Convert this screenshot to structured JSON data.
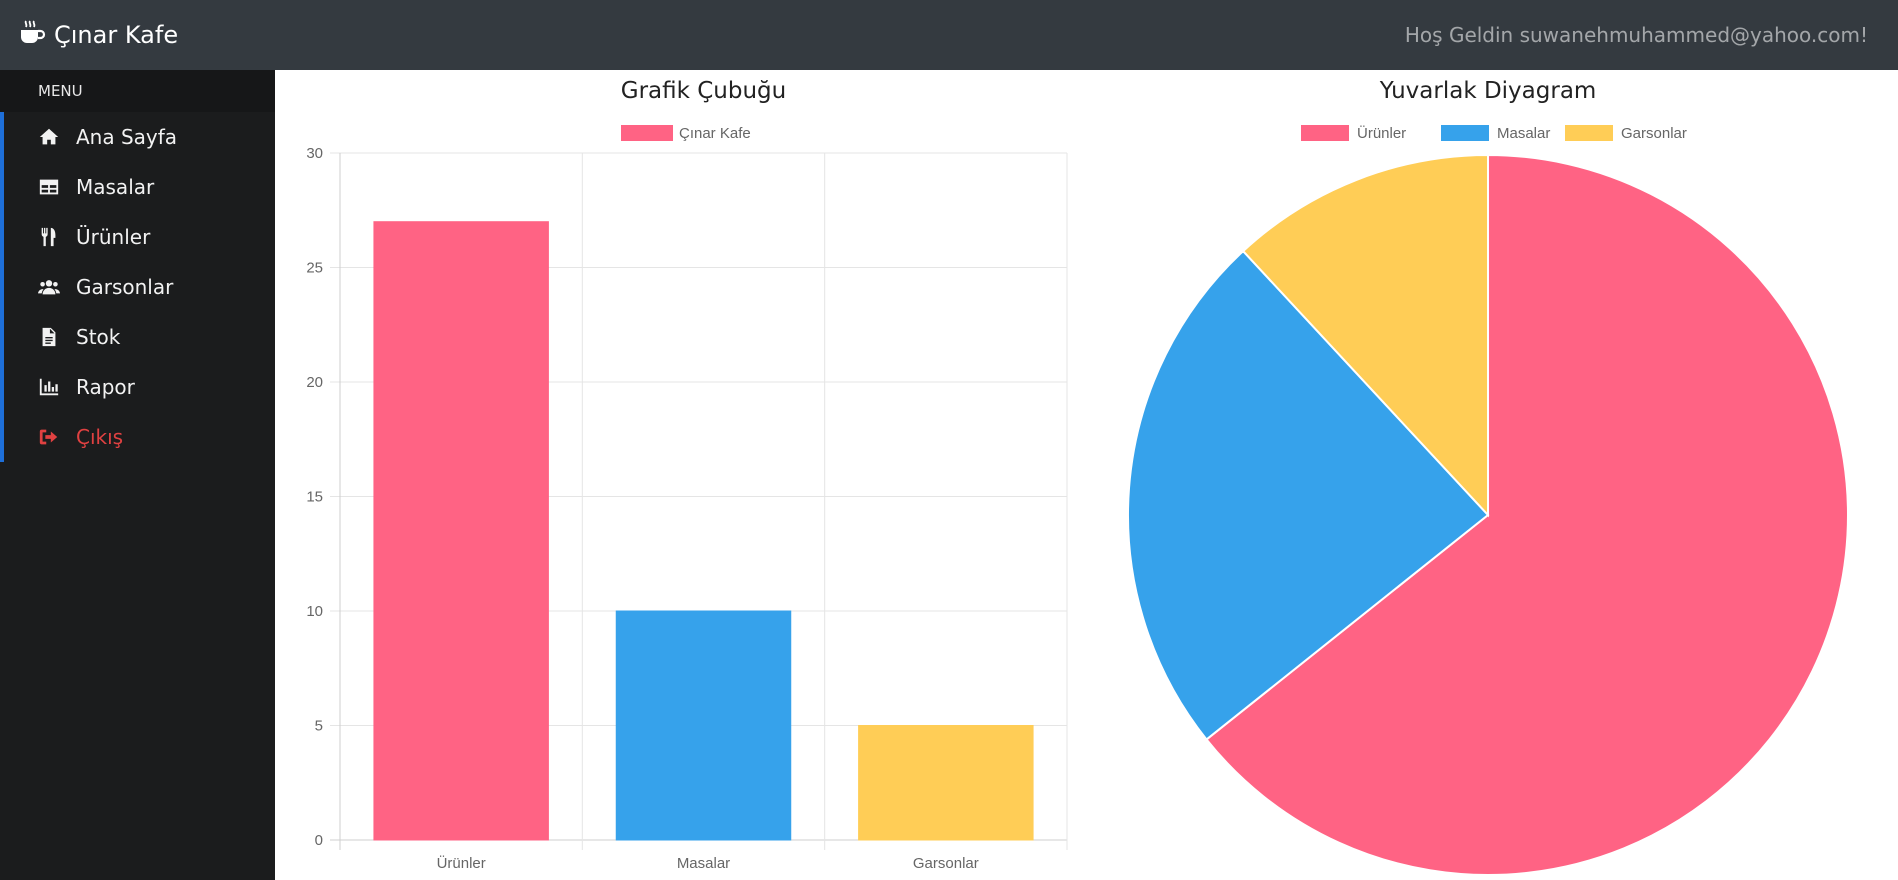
{
  "app": {
    "brand": "Çınar Kafe",
    "welcome": "Hoş Geldin suwanehmuhammed@yahoo.com!"
  },
  "sidebar": {
    "header": "MENU",
    "items": [
      {
        "label": "Ana Sayfa",
        "icon": "home-icon"
      },
      {
        "label": "Masalar",
        "icon": "table-icon"
      },
      {
        "label": "Ürünler",
        "icon": "utensils-icon"
      },
      {
        "label": "Garsonlar",
        "icon": "users-icon"
      },
      {
        "label": "Stok",
        "icon": "file-icon"
      },
      {
        "label": "Rapor",
        "icon": "bar-chart-icon"
      },
      {
        "label": "Çıkış",
        "icon": "sign-out-icon",
        "color": "#e04141"
      }
    ]
  },
  "chart_data": [
    {
      "type": "bar",
      "title": "Grafik Çubuğu",
      "categories": [
        "Ürünler",
        "Masalar",
        "Garsonlar"
      ],
      "series": [
        {
          "name": "Çınar Kafe",
          "values": [
            27,
            10,
            5
          ]
        }
      ],
      "colors": [
        "#ff6384",
        "#36a2eb",
        "#ffcd56"
      ],
      "ylim": [
        0,
        30
      ],
      "yticks": [
        0,
        5,
        10,
        15,
        20,
        25,
        30
      ],
      "grid": true,
      "legend": "top"
    },
    {
      "type": "pie",
      "title": "Yuvarlak Diyagram",
      "labels": [
        "Ürünler",
        "Masalar",
        "Garsonlar"
      ],
      "values": [
        27,
        10,
        5
      ],
      "colors": [
        "#ff6384",
        "#36a2eb",
        "#ffcd56"
      ],
      "legend": "top"
    }
  ]
}
